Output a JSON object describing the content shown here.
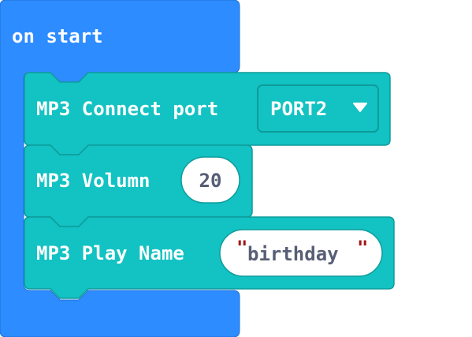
{
  "colors": {
    "event_block": "#2d8cff",
    "event_block_stroke": "#1e6fd9",
    "mp3_block": "#13c2c2",
    "mp3_block_stroke": "#0e9b9b",
    "field_text": "#575e75",
    "string_quote": "#a31515"
  },
  "event": {
    "label": "on start"
  },
  "blocks": [
    {
      "label": "MP3 Connect port",
      "dropdown": {
        "value": "PORT2",
        "icon": "triangle-down-icon"
      }
    },
    {
      "label": "MP3 Volumn",
      "number": "20"
    },
    {
      "label": "MP3 Play Name",
      "string": "birthday",
      "quote": "\""
    }
  ]
}
